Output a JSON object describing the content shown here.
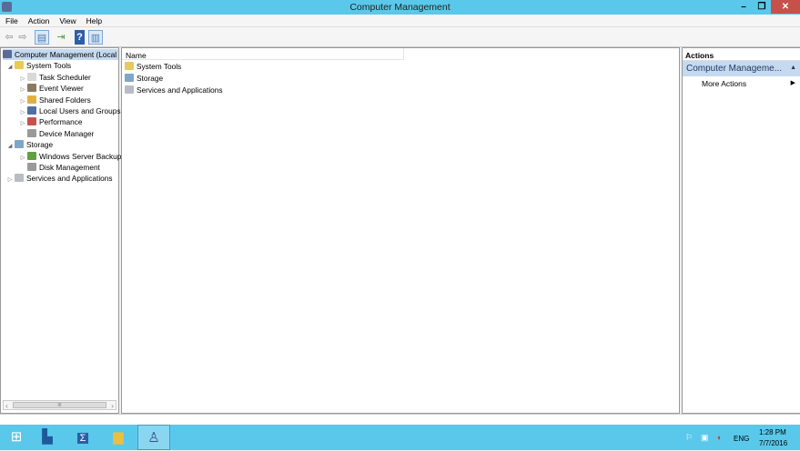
{
  "window": {
    "title": "Computer Management",
    "minimize": "–",
    "restore": "❐",
    "close": "✕"
  },
  "menu": [
    "File",
    "Action",
    "View",
    "Help"
  ],
  "tree": [
    {
      "label": "Computer Management (Local",
      "level": 0,
      "expander": "",
      "selected": true
    },
    {
      "label": "System Tools",
      "level": 1,
      "expander": "◢"
    },
    {
      "label": "Task Scheduler",
      "level": 2,
      "expander": "▷"
    },
    {
      "label": "Event Viewer",
      "level": 2,
      "expander": "▷"
    },
    {
      "label": "Shared Folders",
      "level": 2,
      "expander": "▷"
    },
    {
      "label": "Local Users and Groups",
      "level": 2,
      "expander": "▷"
    },
    {
      "label": "Performance",
      "level": 2,
      "expander": "▷"
    },
    {
      "label": "Device Manager",
      "level": 2,
      "expander": ""
    },
    {
      "label": "Storage",
      "level": 1,
      "expander": "◢"
    },
    {
      "label": "Windows Server Backup",
      "level": 2,
      "expander": "▷"
    },
    {
      "label": "Disk Management",
      "level": 2,
      "expander": ""
    },
    {
      "label": "Services and Applications",
      "level": 1,
      "expander": "▷"
    }
  ],
  "list": {
    "column": "Name",
    "items": [
      "System Tools",
      "Storage",
      "Services and Applications"
    ]
  },
  "actions": {
    "header": "Actions",
    "section": "Computer Manageme...",
    "section_arrow": "▲",
    "item": "More Actions",
    "item_arrow": "▶"
  },
  "scroll": {
    "left": "‹",
    "right": "›",
    "thumb": "III"
  },
  "tray": {
    "lang": "ENG",
    "time": "1:28 PM",
    "date": "7/7/2016"
  },
  "colors": {
    "titlebar": "#5ac8ea",
    "close": "#c7504b",
    "selection": "#c5daf0"
  }
}
